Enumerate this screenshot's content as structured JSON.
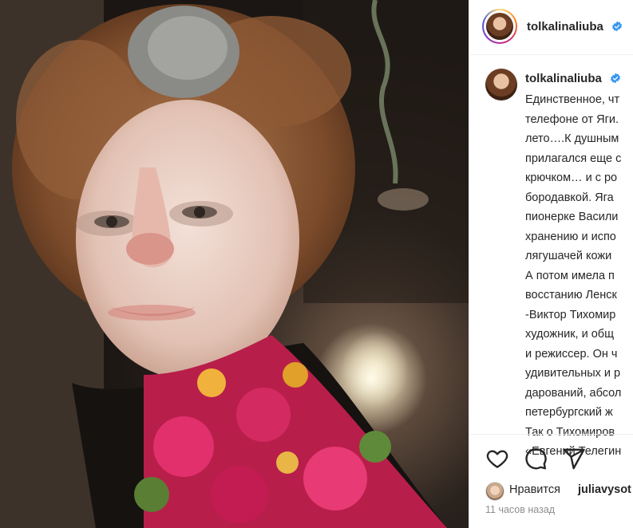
{
  "post": {
    "username": "tolkalinaliuba",
    "verified": true,
    "photo_alt": "photo-of-woman-in-costume",
    "caption_lines": [
      "Единственное, чт",
      "телефоне от Яги.",
      "лето….К душным",
      "прилагался еще с",
      "крючком… и с ро",
      "бородавкой. Яга",
      "пионерке Васили",
      "хранению и испо",
      "лягушачей кожи",
      "А потом имела п",
      "восстанию Ленск",
      "-Виктор Тихомир",
      "художник, и общ",
      "и режиссер. Он ч",
      "удивительных и р",
      "дарований, абсол",
      "петербургский ж",
      "Так о Тихомиров",
      "«Евгений Телегин"
    ],
    "likes_label": "Нравится",
    "likes_user": "juliavysot",
    "timestamp": "11 часов назад"
  },
  "icons": {
    "like": "heart-icon",
    "comment": "comment-icon",
    "share": "share-icon",
    "verified": "verified-badge-icon"
  },
  "colors": {
    "verified": "#3897f0",
    "text": "#262626",
    "muted": "#8e8e8e"
  }
}
